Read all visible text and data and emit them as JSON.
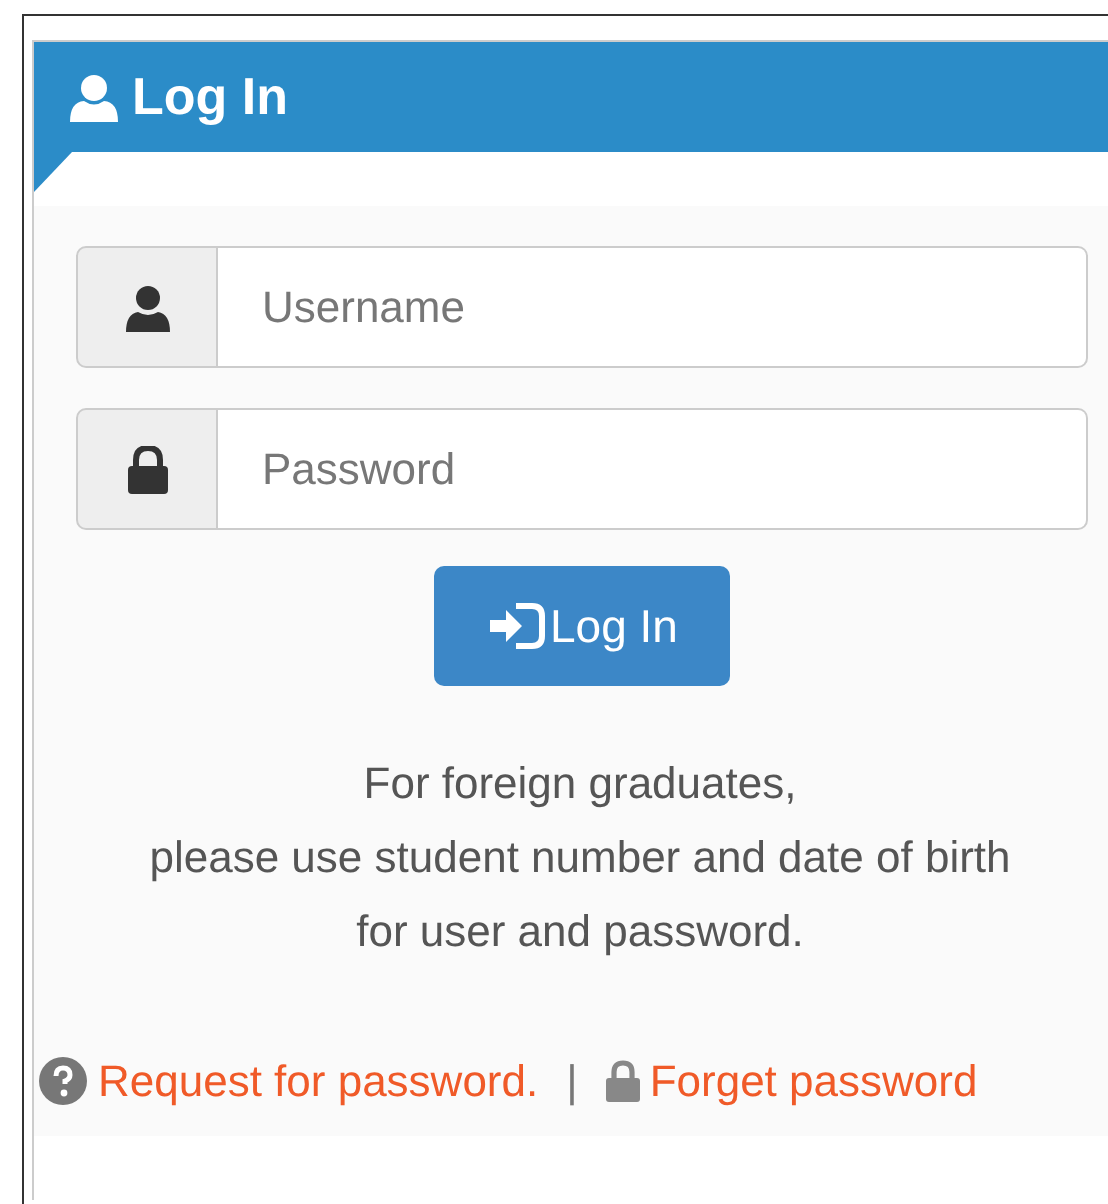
{
  "panel": {
    "title": "Log In"
  },
  "fields": [
    {
      "kind": "user",
      "placeholder": "Username"
    },
    {
      "kind": "password",
      "placeholder": "Password"
    }
  ],
  "submit": {
    "label": "Log In"
  },
  "note": [
    "For foreign graduates,",
    "please use student number and date of birth",
    "for user and password."
  ],
  "links": [
    {
      "kind": "help",
      "label": "Request for password."
    },
    {
      "kind": "lock",
      "label": "Forget password"
    }
  ],
  "separator": "|"
}
